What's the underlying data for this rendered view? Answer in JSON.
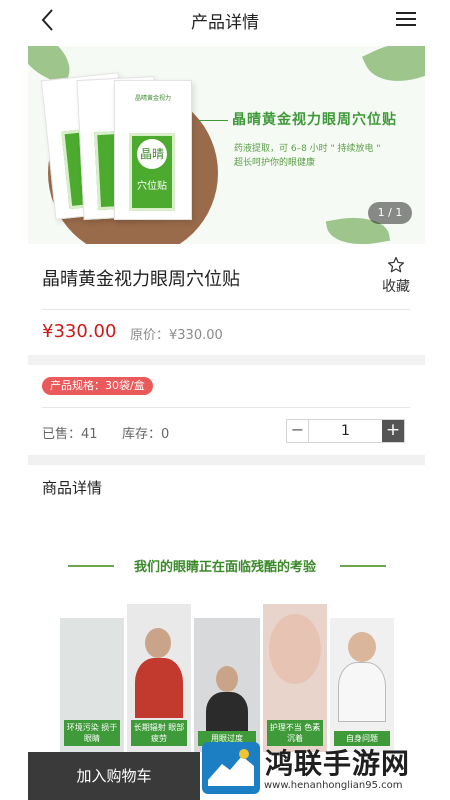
{
  "header": {
    "title": "产品详情",
    "back_icon": "chevron-left-icon",
    "menu_icon": "hamburger-menu-icon"
  },
  "banner": {
    "headline": "晶晴黄金视力眼周穴位贴",
    "sub_line1": "药液提取，可 6–8 小时 \" 持续放电 \"",
    "sub_line2": "超长呵护你的眼健康",
    "bag_brand": "晶晴黄金视力",
    "bag_seal": "晶晴",
    "bag_label": "穴位贴",
    "pager": "1 / 1"
  },
  "product": {
    "name": "晶晴黄金视力眼周穴位贴",
    "favorite_label": "收藏",
    "price": "¥330.00",
    "original_price": "原价：¥330.00",
    "spec": "产品规格：30袋/盒",
    "sold": "已售：41",
    "stock": "库存：0",
    "quantity": "1",
    "minus_symbol": "−",
    "plus_symbol": "+"
  },
  "detail": {
    "title": "商品详情",
    "section_heading": "我们的眼睛正在面临残酷的考验",
    "photos": [
      {
        "caption": "环境污染 损于眼睛"
      },
      {
        "caption": "长期辐射 眼部疲劳"
      },
      {
        "caption": "用眼过度"
      },
      {
        "caption": "护理不当 色素沉着"
      },
      {
        "caption": "自身问题"
      }
    ]
  },
  "bottom": {
    "cart_label": "加入购物车"
  },
  "watermark": {
    "text": "鸿联手游网",
    "url": "www.henanhonglian95.com"
  },
  "colors": {
    "price_red": "#cc1a1a",
    "spec_badge": "#ea5a5a",
    "brand_green": "#3f9a3a",
    "cart_bar": "#3a3a3a"
  }
}
